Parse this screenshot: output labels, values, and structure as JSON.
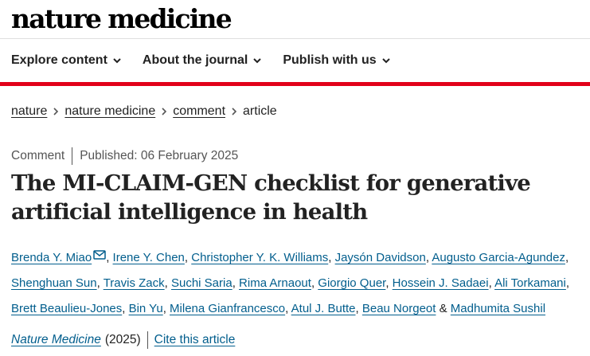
{
  "brand": {
    "part1": "nature",
    "part2": "medicine"
  },
  "nav": [
    {
      "label": "Explore content"
    },
    {
      "label": "About the journal"
    },
    {
      "label": "Publish with us"
    }
  ],
  "breadcrumb": [
    "nature",
    "nature medicine",
    "comment",
    "article"
  ],
  "meta": {
    "type": "Comment",
    "published": "Published: 06 February 2025"
  },
  "title": "The MI-CLAIM-GEN checklist for generative artificial intelligence in health",
  "authors": [
    "Brenda Y. Miao",
    "Irene Y. Chen",
    "Christopher Y. K. Williams",
    "Jaysón Davidson",
    "Augusto Garcia-Agundez",
    "Shenghuan Sun",
    "Travis Zack",
    "Suchi Saria",
    "Rima Arnaout",
    "Giorgio Quer",
    "Hossein J. Sadaei",
    "Ali Torkamani",
    "Brett Beaulieu-Jones",
    "Bin Yu",
    "Milena Gianfrancesco",
    "Atul J. Butte",
    "Beau Norgeot",
    "Madhumita Sushil"
  ],
  "author_separator": ",",
  "author_last_separator": "&",
  "citation": {
    "journal": "Nature Medicine",
    "year": "(2025)",
    "cite_label": "Cite this article"
  },
  "colors": {
    "accent_red": "#e2001a",
    "link_blue": "#025e8d",
    "text": "#222222"
  },
  "icons": {
    "nav_chevron": "chevron-down-icon",
    "breadcrumb_separator": "chevron-right-icon",
    "author_contact": "envelope-icon"
  }
}
